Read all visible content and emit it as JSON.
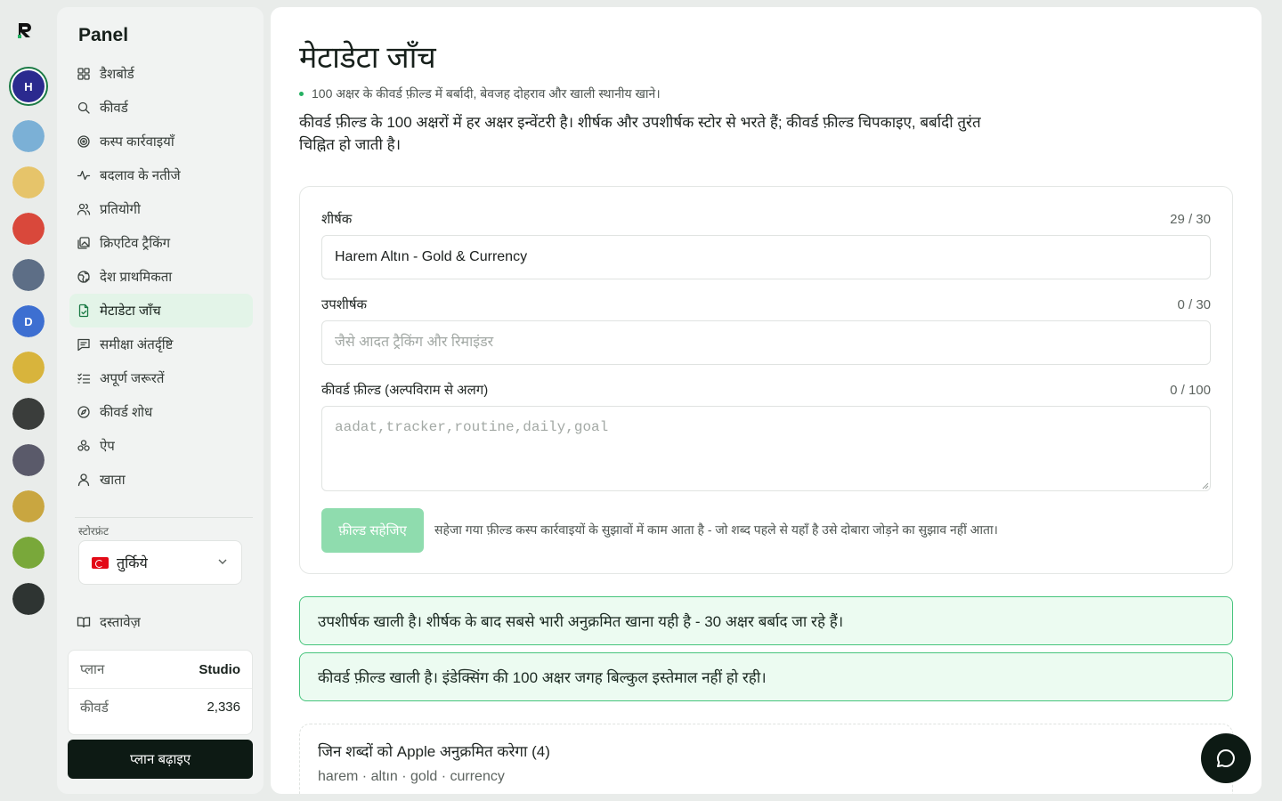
{
  "app": {
    "logo_text": "R"
  },
  "rail_apps": [
    {
      "name": "Harem Altın",
      "letter": "H",
      "color": "#2b2a8f",
      "active": true
    },
    {
      "name": "app-2",
      "letter": "",
      "color": "#7bb0d6"
    },
    {
      "name": "app-3",
      "letter": "",
      "color": "#e6c46a"
    },
    {
      "name": "app-4",
      "letter": "",
      "color": "#d9483b"
    },
    {
      "name": "app-5",
      "letter": "",
      "color": "#5d6e86"
    },
    {
      "name": "app-6",
      "letter": "D",
      "color": "#3d6fd1"
    },
    {
      "name": "app-7",
      "letter": "",
      "color": "#d8b43c"
    },
    {
      "name": "app-8",
      "letter": "",
      "color": "#3a3d3b"
    },
    {
      "name": "app-9",
      "letter": "",
      "color": "#5a5a6a"
    },
    {
      "name": "app-10",
      "letter": "",
      "color": "#c9a640"
    },
    {
      "name": "app-11",
      "letter": "",
      "color": "#79a83a"
    },
    {
      "name": "app-12",
      "letter": "",
      "color": "#2e3432"
    }
  ],
  "sidebar": {
    "brand": "Panel",
    "items": [
      {
        "label": "डैशबोर्ड",
        "icon": "dashboard-icon",
        "active": false
      },
      {
        "label": "कीवर्ड",
        "icon": "search-icon",
        "active": false
      },
      {
        "label": "कस्प कार्रवाइयाँ",
        "icon": "target-icon",
        "active": false
      },
      {
        "label": "बदलाव के नतीजे",
        "icon": "activity-icon",
        "active": false
      },
      {
        "label": "प्रतियोगी",
        "icon": "users-icon",
        "active": false
      },
      {
        "label": "क्रिएटिव ट्रैकिंग",
        "icon": "images-icon",
        "active": false
      },
      {
        "label": "देश प्राथमिकता",
        "icon": "globe-icon",
        "active": false
      },
      {
        "label": "मेटाडेटा जाँच",
        "icon": "file-check-icon",
        "active": true
      },
      {
        "label": "समीक्षा अंतर्दृष्टि",
        "icon": "message-icon",
        "active": false
      },
      {
        "label": "अपूर्ण जरूरतें",
        "icon": "checklist-icon",
        "active": false
      },
      {
        "label": "कीवर्ड शोध",
        "icon": "compass-icon",
        "active": false
      },
      {
        "label": "ऐप",
        "icon": "apps-icon",
        "active": false
      },
      {
        "label": "खाता",
        "icon": "user-icon",
        "active": false
      }
    ],
    "storefront_label": "स्टोरफ्रंट",
    "storefront_value": "तुर्किये",
    "docs_label": "दस्तावेज़",
    "plan": {
      "plan_key": "प्लान",
      "plan_value": "Studio",
      "kw_key": "कीवर्ड",
      "kw_value": "2,336"
    },
    "upgrade_label": "प्लान बढ़ाइए"
  },
  "main": {
    "title": "मेटाडेटा जाँच",
    "subtitle": "100 अक्षर के कीवर्ड फ़ील्ड में बर्बादी, बेवजह दोहराव और खाली स्थानीय खाने।",
    "description": "कीवर्ड फ़ील्ड के 100 अक्षरों में हर अक्षर इन्वेंटरी है। शीर्षक और उपशीर्षक स्टोर से भरते हैं; कीवर्ड फ़ील्ड चिपकाइए, बर्बादी तुरंत चिह्नित हो जाती है।",
    "fields": {
      "title": {
        "label": "शीर्षक",
        "count": "29 / 30",
        "value": "Harem Altın - Gold & Currency"
      },
      "subtitle": {
        "label": "उपशीर्षक",
        "count": "0 / 30",
        "placeholder": "जैसे आदत ट्रैकिंग और रिमाइंडर"
      },
      "keywords": {
        "label": "कीवर्ड फ़ील्ड (अल्पविराम से अलग)",
        "count": "0 / 100",
        "placeholder": "aadat,tracker,routine,daily,goal"
      }
    },
    "save_label": "फ़ील्ड सहेजिए",
    "save_note": "सहेजा गया फ़ील्ड कस्प कार्रवाइयों के सुझावों में काम आता है - जो शब्द पहले से यहाँ है उसे दोबारा जोड़ने का सुझाव नहीं आता।",
    "alerts": [
      "उपशीर्षक खाली है। शीर्षक के बाद सबसे भारी अनुक्रमित खाना यही है - 30 अक्षर बर्बाद जा रहे हैं।",
      "कीवर्ड फ़ील्ड खाली है। इंडेक्सिंग की 100 अक्षर जगह बिल्कुल इस्तेमाल नहीं हो रही।"
    ],
    "indexed": {
      "title": "जिन शब्दों को Apple अनुक्रमित करेगा (4)",
      "words": "harem · altın · gold · currency"
    }
  },
  "colors": {
    "accent": "#25b062",
    "active_nav_bg": "#e3f4e8",
    "alert_bg": "#ecfbf1",
    "alert_border": "#46c47c",
    "dark": "#0d1a14"
  }
}
